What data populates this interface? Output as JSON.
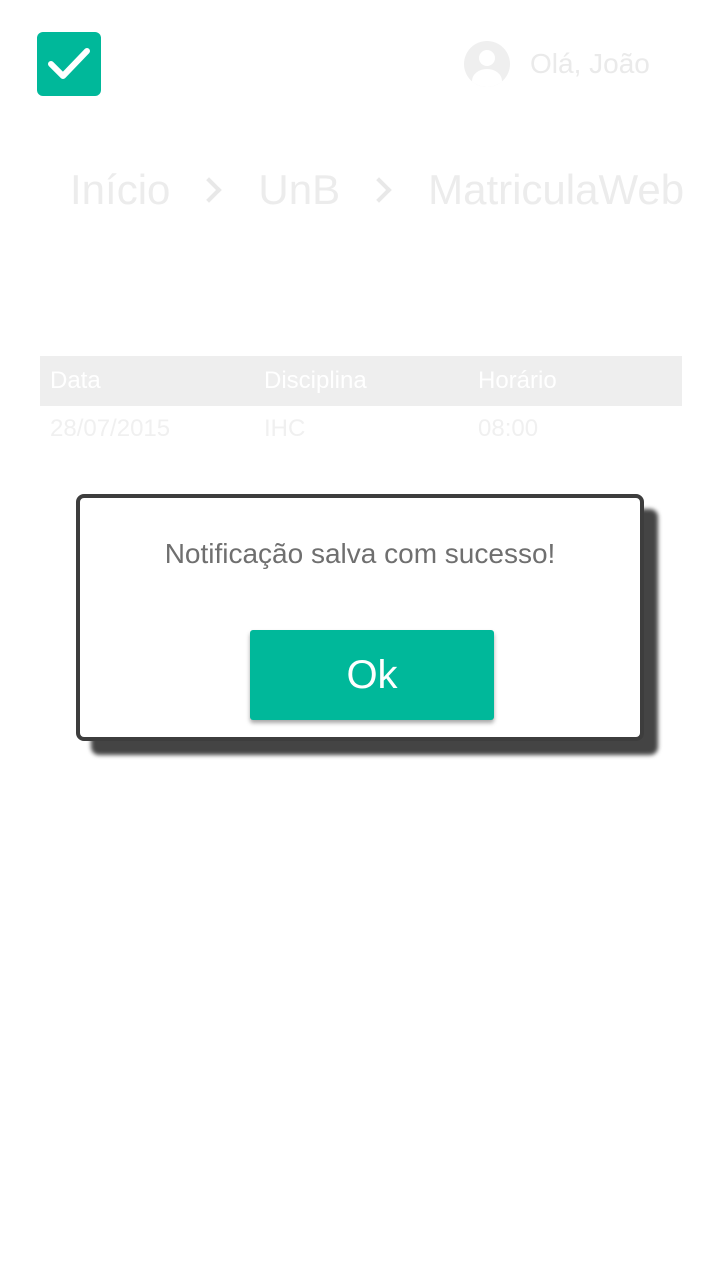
{
  "header": {
    "logo_icon": "checkmark-icon",
    "brand_color": "#00b89a",
    "user_icon": "user-avatar-icon",
    "greeting": "Olá, João"
  },
  "breadcrumb": {
    "items": [
      "Início",
      "UnB",
      "MatriculaWeb"
    ],
    "separator_icon": "chevron-right-icon"
  },
  "table": {
    "columns": [
      "Data",
      "Disciplina",
      "Horário"
    ],
    "rows": [
      [
        "28/07/2015",
        "IHC",
        "08:00"
      ]
    ]
  },
  "dialog": {
    "message": "Notificação salva com sucesso!",
    "ok_label": "Ok"
  }
}
